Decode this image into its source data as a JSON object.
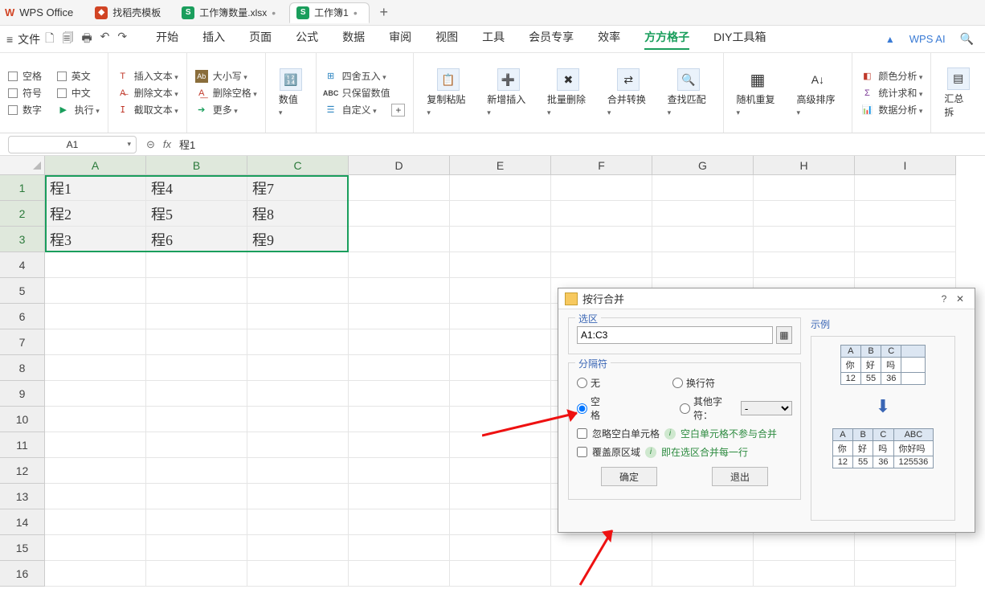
{
  "app": {
    "logo_text": "W",
    "name": "WPS Office"
  },
  "tabs": [
    {
      "icon_bg": "#d14424",
      "icon_text": "",
      "label": "找稻壳模板"
    },
    {
      "icon_bg": "#1a9e5c",
      "icon_text": "S",
      "label": "工作簿数量.xlsx"
    },
    {
      "icon_bg": "#1a9e5c",
      "icon_text": "S",
      "label": "工作簿1",
      "active": true
    }
  ],
  "menu": {
    "file": "文件",
    "items": [
      "开始",
      "插入",
      "页面",
      "公式",
      "数据",
      "审阅",
      "视图",
      "工具",
      "会员专享",
      "效率",
      "方方格子",
      "DIY工具箱"
    ],
    "active_index": 10,
    "ai": "WPS AI"
  },
  "ribbon": {
    "g1": {
      "space": "空格",
      "english": "英文",
      "symbol": "符号",
      "chinese": "中文",
      "number": "数字",
      "execute": "执行"
    },
    "g2": {
      "insert_text": "插入文本",
      "delete_text": "删除文本",
      "extract_text": "截取文本"
    },
    "g3": {
      "case": "大小写",
      "del_space": "删除空格",
      "more": "更多"
    },
    "g4": {
      "numeric": "数值"
    },
    "g5": {
      "round": "四舍五入",
      "keep_num": "只保留数值",
      "custom": "自定义"
    },
    "g6": {
      "copy_paste": "复制粘贴",
      "new_insert": "新增插入",
      "bulk_del": "批量删除",
      "merge": "合并转换",
      "find": "查找匹配"
    },
    "g7": {
      "rand": "随机重复",
      "sort": "高级排序"
    },
    "g8": {
      "color": "颜色分析",
      "stat": "统计求和",
      "data": "数据分析"
    },
    "g9": {
      "pivot": "汇总拆"
    }
  },
  "namebox": "A1",
  "formula": "程1",
  "columns": [
    "A",
    "B",
    "C",
    "D",
    "E",
    "F",
    "G",
    "H",
    "I"
  ],
  "selected_cols": [
    0,
    1,
    2
  ],
  "rows_count": 16,
  "selected_rows": [
    0,
    1,
    2
  ],
  "cells": [
    [
      "程1",
      "程4",
      "程7"
    ],
    [
      "程2",
      "程5",
      "程8"
    ],
    [
      "程3",
      "程6",
      "程9"
    ]
  ],
  "dialog": {
    "title": "按行合并",
    "sel_label": "选区",
    "range": "A1:C3",
    "sep_label": "分隔符",
    "sep_none": "无",
    "sep_newline": "换行符",
    "sep_space": "空格",
    "sep_other": "其他字符：",
    "sep_other_val": "-",
    "chk_skip": "忽略空白单元格",
    "tip_skip": "空白单元格不参与合并",
    "chk_overwrite": "覆盖原区域",
    "tip_overwrite": "即在选区合并每一行",
    "ok": "确定",
    "exit": "退出",
    "example_label": "示例",
    "tbl1_h": [
      "A",
      "B",
      "C"
    ],
    "tbl1_r1": [
      "你",
      "好",
      "吗"
    ],
    "tbl1_r2": [
      "12",
      "55",
      "36"
    ],
    "tbl2_h": [
      "A",
      "B",
      "C",
      "ABC"
    ],
    "tbl2_r1": [
      "你",
      "好",
      "吗",
      "你好吗"
    ],
    "tbl2_r2": [
      "12",
      "55",
      "36",
      "125536"
    ]
  }
}
